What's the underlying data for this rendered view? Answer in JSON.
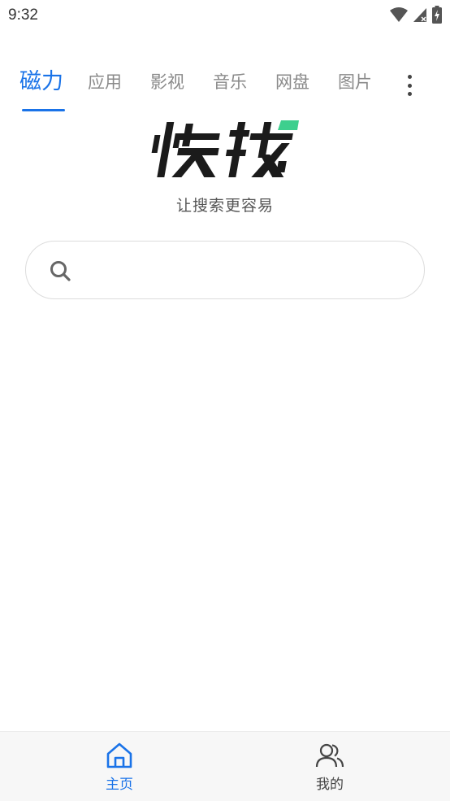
{
  "status_bar": {
    "time": "9:32",
    "icons": [
      "wifi-icon",
      "signal-icon",
      "battery-charging-icon"
    ]
  },
  "tabs": [
    {
      "label": "磁力",
      "active": true
    },
    {
      "label": "应用",
      "active": false
    },
    {
      "label": "影视",
      "active": false
    },
    {
      "label": "音乐",
      "active": false
    },
    {
      "label": "网盘",
      "active": false
    },
    {
      "label": "图片",
      "active": false
    }
  ],
  "more_menu_icon": "more-vertical-icon",
  "logo": {
    "text": "快找",
    "accent_color": "#3ecf8e"
  },
  "tagline": "让搜索更容易",
  "search": {
    "placeholder": "",
    "value": "",
    "icon": "search-icon"
  },
  "bottom_nav": {
    "items": [
      {
        "label": "主页",
        "icon": "home-icon",
        "active": true
      },
      {
        "label": "我的",
        "icon": "users-icon",
        "active": false
      }
    ]
  },
  "colors": {
    "accent": "#1a73e8",
    "inactive_tab": "#8a8a8a",
    "logo_green": "#3ecf8e"
  }
}
